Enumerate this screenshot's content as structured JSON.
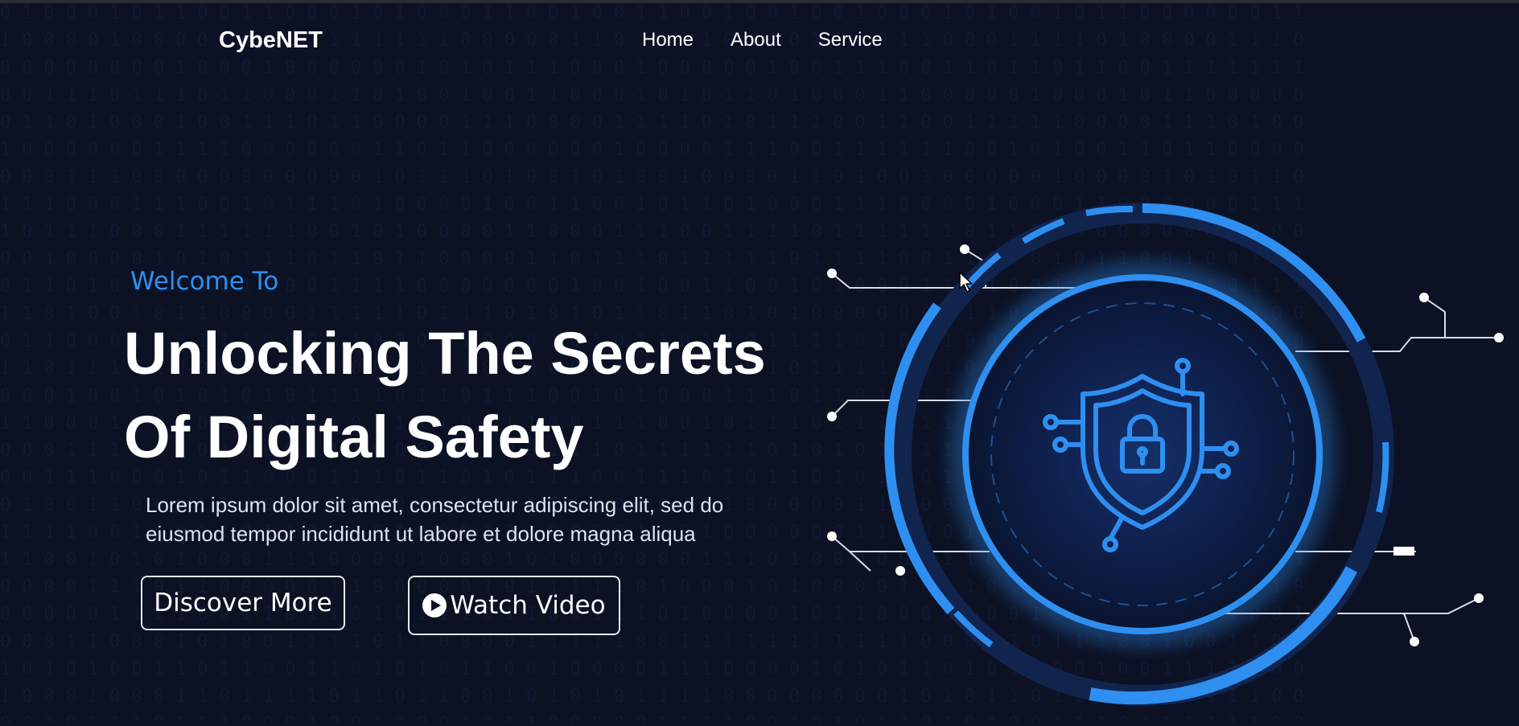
{
  "nav": {
    "logo": "CybeNET",
    "links": [
      "Home",
      "About",
      "Service"
    ]
  },
  "hero": {
    "eyebrow": "Welcome To",
    "title_line1": "Unlocking The Secrets",
    "title_line2": "Of Digital Safety",
    "description_line1": "Lorem ipsum dolor sit amet, consectetur adipiscing elit, sed do",
    "description_line2": "eiusmod tempor incididunt ut labore et dolore magna aliqua",
    "primary_button": "Discover More",
    "secondary_button": "Watch Video"
  },
  "theme": {
    "background": "#0c1124",
    "accent": "#2e8ff0",
    "text": "#ffffff"
  },
  "icons": [
    "play-icon",
    "shield-lock-icon",
    "cursor-icon"
  ]
}
